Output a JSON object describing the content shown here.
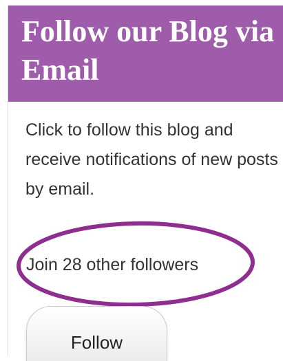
{
  "widget": {
    "title": "Follow our Blog via Email",
    "description": "Click to follow this blog and receive notifications of new posts by email.",
    "followers_text": "Join 28 other followers",
    "follow_button_label": "Follow"
  },
  "colors": {
    "header_background": "#9e5cab",
    "highlight_ellipse": "#8e2e8f"
  }
}
